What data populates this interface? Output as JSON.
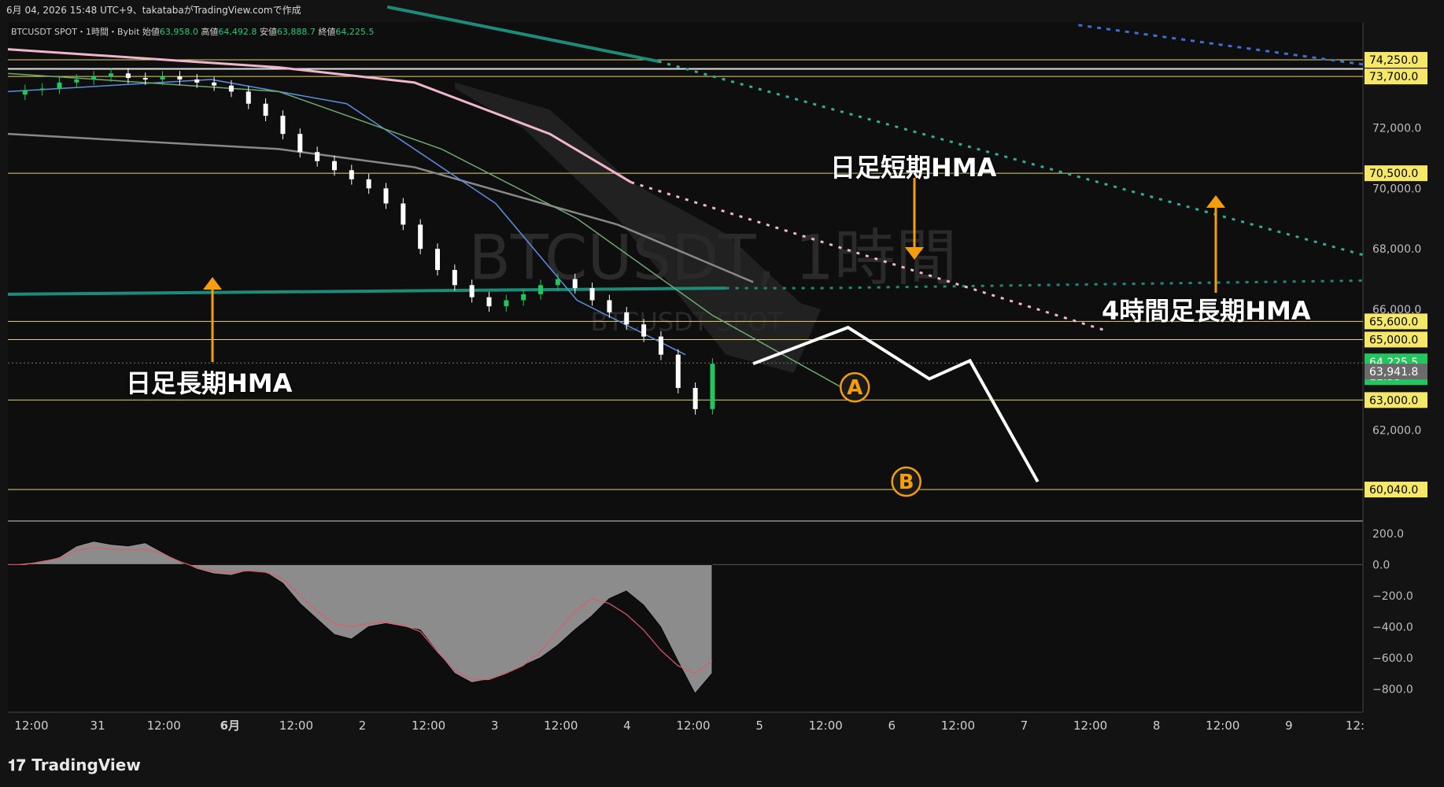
{
  "header": {
    "timestamp_line": "6月 04, 2026 15:48 UTC+9、takatabaがTradingView.comで作成"
  },
  "legend": {
    "symbol": "BTCUSDT SPOT・1時間・Bybit",
    "open_label": "始値",
    "open": "63,958.0",
    "high_label": "高値",
    "high": "64,492.8",
    "low_label": "安値",
    "low": "63,888.7",
    "close_label": "終値",
    "close": "64,225.5"
  },
  "watermark": {
    "main": "BTCUSDT, 1時間",
    "sub": "BTCUSDT SPOT"
  },
  "annotations": {
    "daily_short_hma": "日足短期HMA",
    "daily_long_hma": "日足長期HMA",
    "h4_long_hma": "4時間足長期HMA",
    "marker_a": "A",
    "marker_b": "B"
  },
  "footer": {
    "brand": "TradingView"
  },
  "colors": {
    "background": "#131313",
    "candle_up": "#22c55e",
    "candle_down": "#ffffff",
    "level_line": "#e6d46a",
    "level_tag": "#f5e76a",
    "current_price_tag": "#22c55e",
    "hma_teal": "#1e8a78",
    "hma_pink": "#f0b4cc",
    "hma_blue_dashed": "#3b6fd6",
    "arrow": "#f59e0b",
    "marker": "#f59e0b"
  },
  "chart_data": [
    {
      "type": "line",
      "name_hint": "price-panel",
      "ylim": [
        59000,
        75500
      ],
      "x_ticks": [
        "12:00",
        "31",
        "12:00",
        "6月",
        "12:00",
        "2",
        "12:00",
        "3",
        "12:00",
        "4",
        "12:00",
        "5",
        "12:00",
        "6",
        "12:00",
        "7",
        "12:00",
        "8",
        "12:00",
        "9",
        "12:"
      ],
      "y_ticks": [
        72000,
        70000,
        68000,
        66000,
        64000,
        62000
      ],
      "y_tick_labels": [
        "72,000.0",
        "70,000.0",
        "68,000.0",
        "66,000.0",
        "64,000.0",
        "62,000.0"
      ],
      "price_levels": [
        {
          "value": 74250,
          "label": "74,250.0"
        },
        {
          "value": 73700,
          "label": "73,700.0"
        },
        {
          "value": 70500,
          "label": "70,500.0"
        },
        {
          "value": 65600,
          "label": "65,600.0"
        },
        {
          "value": 65000,
          "label": "65,000.0"
        },
        {
          "value": 63000,
          "label": "63,000.0"
        },
        {
          "value": 60040,
          "label": "60,040.0"
        }
      ],
      "current_price": {
        "value": 64225.5,
        "label": "64,225.5",
        "countdown": "11:33"
      },
      "reference_price": {
        "value": 63941.8,
        "label": "63,941.8"
      },
      "price_path": [
        73100,
        73250,
        73300,
        73500,
        73600,
        73700,
        73800,
        73650,
        73600,
        73700,
        73600,
        73500,
        73400,
        73200,
        72800,
        72400,
        71800,
        71200,
        70900,
        70600,
        70300,
        70000,
        69500,
        68800,
        68000,
        67300,
        66800,
        66400,
        66100,
        66300,
        66500,
        66800,
        67000,
        66700,
        66300,
        65900,
        65500,
        65100,
        64500,
        63400,
        62700,
        64200
      ],
      "projection": [
        [
          0.55,
          64200
        ],
        [
          0.62,
          65400
        ],
        [
          0.68,
          63700
        ],
        [
          0.71,
          64300
        ],
        [
          0.76,
          60300
        ]
      ],
      "hma_daily_long": [
        [
          0.0,
          66500
        ],
        [
          0.53,
          66700
        ],
        [
          0.6,
          66700
        ],
        [
          1.0,
          66950
        ]
      ],
      "hma_daily_short": [
        [
          0.5,
          71000
        ],
        [
          0.84,
          65200
        ]
      ],
      "hma_h4_long": [
        [
          0.0,
          78000
        ],
        [
          0.5,
          74000
        ],
        [
          1.0,
          67800
        ]
      ],
      "hma_blue": [
        [
          0.79,
          75400
        ],
        [
          1.0,
          74100
        ]
      ],
      "ema_gray": [
        [
          0.0,
          71800
        ],
        [
          0.2,
          71300
        ],
        [
          0.3,
          70700
        ],
        [
          0.45,
          68800
        ],
        [
          0.55,
          66900
        ]
      ]
    },
    {
      "type": "area",
      "name_hint": "oscillator-panel",
      "ylim": [
        -950,
        280
      ],
      "y_ticks": [
        200,
        0,
        -200,
        -400,
        -600,
        -800
      ],
      "y_tick_labels": [
        "200.0",
        "0.0",
        "−200.0",
        "−400.0",
        "−600.0",
        "−800.0"
      ],
      "histogram": [
        0,
        10,
        20,
        50,
        120,
        150,
        130,
        120,
        140,
        80,
        20,
        -30,
        -60,
        -70,
        -40,
        -50,
        -120,
        -250,
        -350,
        -450,
        -480,
        -400,
        -380,
        -400,
        -420,
        -560,
        -700,
        -760,
        -740,
        -700,
        -650,
        -600,
        -520,
        -420,
        -330,
        -220,
        -170,
        -260,
        -400,
        -620,
        -830,
        -700
      ],
      "signal": [
        0,
        0,
        20,
        40,
        90,
        110,
        100,
        95,
        100,
        70,
        20,
        -20,
        -40,
        -50,
        -40,
        -50,
        -90,
        -200,
        -300,
        -380,
        -400,
        -380,
        -370,
        -390,
        -430,
        -560,
        -680,
        -740,
        -740,
        -700,
        -650,
        -560,
        -430,
        -300,
        -220,
        -250,
        -320,
        -420,
        -550,
        -650,
        -700,
        -620
      ]
    }
  ]
}
